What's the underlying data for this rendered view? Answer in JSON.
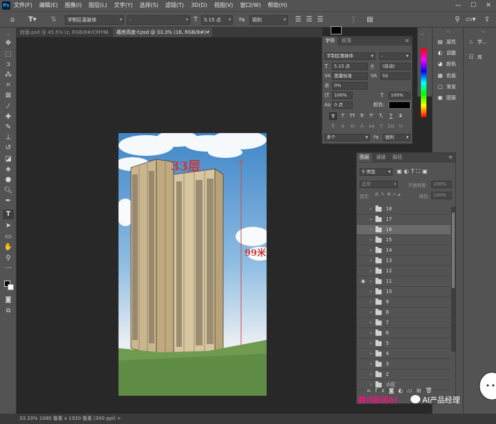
{
  "menubar": {
    "logo": "Ps",
    "items": [
      "文件(F)",
      "编辑(E)",
      "图像(I)",
      "图层(L)",
      "文字(Y)",
      "选择(S)",
      "滤镜(T)",
      "3D(D)",
      "视图(V)",
      "窗口(W)",
      "帮助(H)"
    ],
    "win_controls": [
      "—",
      "☐",
      "✕"
    ]
  },
  "optbar": {
    "font_family": "字制区喜脉体",
    "font_style": "-",
    "font_size": "5.15 点",
    "antialias": "锐利",
    "text_color": "#000000"
  },
  "tabs": [
    {
      "label": "封面.psd @ 45.5% (z, RGB/8#/CMYK)",
      "close": "×"
    },
    {
      "label": "楼房高度-f.psd @ 33.3% (16, RGB/8#) *",
      "close": "×"
    }
  ],
  "character_panel": {
    "tab_character": "字符",
    "tab_paragraph": "段落",
    "font_family": "字制区喜脉体",
    "font_style": "-",
    "font_size": "5.15 点",
    "leading": "(自动)",
    "kerning": "度量标准",
    "tracking": "50",
    "scale_percent": "0%",
    "vertical_scale": "100%",
    "horizontal_scale": "100%",
    "baseline_shift": "0 点",
    "color_label": "颜色:",
    "color": "#000000",
    "style_buttons": [
      "T",
      "T",
      "TT",
      "Tr",
      "T'",
      "T,",
      "T",
      "T"
    ],
    "opentype_buttons": [
      "fi",
      "σ",
      "st",
      "A",
      "aa",
      "T",
      "1st",
      "½"
    ],
    "language": "多个",
    "antialias": "锐利"
  },
  "dock": {
    "items": [
      {
        "icon": "bulb-icon",
        "label": "学..."
      },
      {
        "icon": "library-icon",
        "label": "库"
      }
    ],
    "mini_items": [
      {
        "icon": "properties-icon",
        "label": "属性"
      },
      {
        "icon": "adjust-icon",
        "label": "调整"
      },
      {
        "icon": "color-icon",
        "label": "颜色"
      },
      {
        "icon": "swatch-icon",
        "label": "色板"
      },
      {
        "icon": "gradient-icon",
        "label": "渐变"
      },
      {
        "icon": "pattern-icon",
        "label": "图案"
      }
    ]
  },
  "layers_panel": {
    "tabs": [
      "图层",
      "通道",
      "路径"
    ],
    "filter_kind": "类型",
    "blend_mode": "正常",
    "opacity_label": "不透明度:",
    "opacity": "100%",
    "lock_label": "锁定:",
    "fill_label": "填充:",
    "fill": "100%",
    "layers": [
      "18",
      "17",
      "16",
      "15",
      "14",
      "13",
      "12",
      "11",
      "10",
      "9",
      "8",
      "7",
      "6",
      "5",
      "4",
      "3",
      "2",
      "小区"
    ],
    "selected_layer": "16",
    "visible_layer": "11"
  },
  "artwork": {
    "floors_label": "33层",
    "height_label": "99米"
  },
  "statusbar": {
    "text": "33.33%    1080 像素 x 1920 像素 (300 ppi)    >"
  },
  "watermark": {
    "left": "腾讯新闻AI",
    "right": "AI产品经理"
  }
}
